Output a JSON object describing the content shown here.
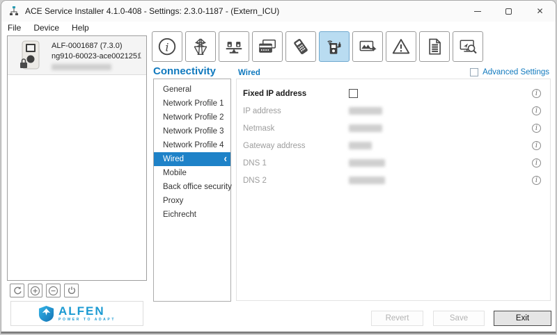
{
  "window": {
    "title": "ACE Service Installer 4.1.0-408 - Settings: 2.3.0-1187 -  (Extern_ICU)"
  },
  "menubar": {
    "items": [
      "File",
      "Device",
      "Help"
    ]
  },
  "sidebar": {
    "device": {
      "title": "ALF-0001687 (7.3.0)",
      "subtitle": "ng910-60023-ace0021251",
      "detail_redacted": true
    },
    "actions": [
      "refresh",
      "add-device",
      "remove-device",
      "power"
    ]
  },
  "toolbar": {
    "tabs": [
      "info",
      "power-grid",
      "load-balancing",
      "payment-cards",
      "payment-terminal",
      "connectivity",
      "display",
      "warnings",
      "logs",
      "diagnostics"
    ],
    "selected": "connectivity"
  },
  "main": {
    "section_title": "Connectivity",
    "nav": {
      "items": [
        "General",
        "Network Profile 1",
        "Network Profile 2",
        "Network Profile 3",
        "Network Profile 4",
        "Wired",
        "Mobile",
        "Back office security",
        "Proxy",
        "Eichrecht"
      ],
      "selected": "Wired"
    },
    "panel": {
      "title": "Wired",
      "advanced_settings_label": "Advanced Settings",
      "advanced_settings_checked": false,
      "rows": [
        {
          "label": "Fixed IP address",
          "control": "checkbox",
          "checked": false
        },
        {
          "label": "IP address",
          "control": "value",
          "redacted": true
        },
        {
          "label": "Netmask",
          "control": "value",
          "redacted": true
        },
        {
          "label": "Gateway address",
          "control": "value",
          "redacted": true
        },
        {
          "label": "DNS 1",
          "control": "value",
          "redacted": true
        },
        {
          "label": "DNS 2",
          "control": "value",
          "redacted": true
        }
      ]
    }
  },
  "footer": {
    "revert_label": "Revert",
    "save_label": "Save",
    "exit_label": "Exit"
  },
  "branding": {
    "name": "ALFEN",
    "tagline": "POWER TO ADAPT"
  },
  "icons": {
    "close": "✕",
    "chevron_left": "‹"
  },
  "colors": {
    "accent": "#1079BE",
    "selection": "#1E82C8",
    "toolbar_selected_bg": "#B9DCF1",
    "logo_blue": "#1B9AD2"
  }
}
